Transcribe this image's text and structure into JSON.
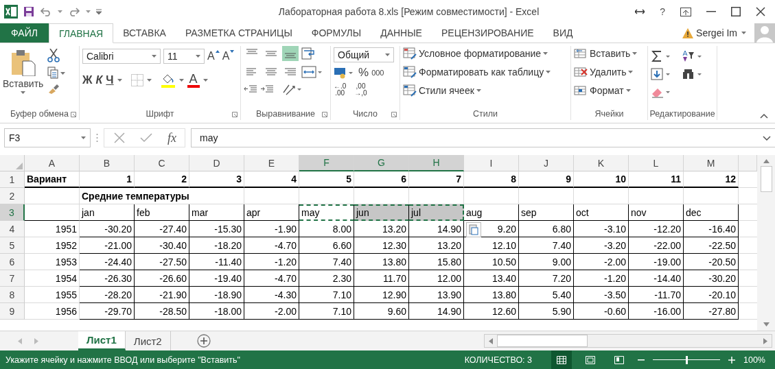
{
  "window": {
    "title": "Лабораторная работа 8.xls  [Режим совместимости] - Excel",
    "help": "?"
  },
  "tabs": [
    {
      "label": "ФАЙЛ",
      "kind": "file",
      "selected": false
    },
    {
      "label": "ГЛАВНАЯ",
      "kind": "tab",
      "selected": true
    },
    {
      "label": "ВСТАВКА",
      "kind": "tab",
      "selected": false
    },
    {
      "label": "РАЗМЕТКА СТРАНИЦЫ",
      "kind": "tab",
      "selected": false
    },
    {
      "label": "ФОРМУЛЫ",
      "kind": "tab",
      "selected": false
    },
    {
      "label": "ДАННЫЕ",
      "kind": "tab",
      "selected": false
    },
    {
      "label": "РЕЦЕНЗИРОВАНИЕ",
      "kind": "tab",
      "selected": false
    },
    {
      "label": "ВИД",
      "kind": "tab",
      "selected": false
    }
  ],
  "user": {
    "name": "Sergei Im"
  },
  "ribbon": {
    "clipboard": {
      "paste": "Вставить",
      "label": "Буфер обмена"
    },
    "font": {
      "name": "Calibri",
      "size": "11",
      "grow": "A",
      "shrink": "A",
      "bold": "Ж",
      "italic": "К",
      "underline": "Ч",
      "color_letter": "A",
      "label": "Шрифт"
    },
    "alignment": {
      "label": "Выравнивание",
      "buttons": [
        {
          "selected": false
        },
        {
          "selected": false
        },
        {
          "selected": true
        },
        {
          "selected": false
        },
        {
          "selected": false
        },
        {
          "selected": false
        }
      ]
    },
    "number": {
      "format": "Общий",
      "percent": "%",
      "thousands": "000",
      "increase_decimal": [
        "←.0",
        ".00"
      ],
      "decrease_decimal": [
        ",00",
        "→,0"
      ],
      "label": "Число"
    },
    "styles": {
      "buttons": [
        "Условное форматирование",
        "Форматировать как таблицу",
        "Стили ячеек"
      ],
      "label": "Стили"
    },
    "cells": {
      "buttons": [
        "Вставить",
        "Удалить",
        "Формат"
      ],
      "label": "Ячейки"
    },
    "editing": {
      "label": "Редактирование"
    }
  },
  "formula_bar": {
    "name_box": "F3",
    "fx": "fx",
    "value": "may"
  },
  "columns": [
    {
      "label": "A",
      "selected": false
    },
    {
      "label": "B",
      "selected": false
    },
    {
      "label": "C",
      "selected": false
    },
    {
      "label": "D",
      "selected": false
    },
    {
      "label": "E",
      "selected": false
    },
    {
      "label": "F",
      "selected": true
    },
    {
      "label": "G",
      "selected": true
    },
    {
      "label": "H",
      "selected": true
    },
    {
      "label": "I",
      "selected": false
    },
    {
      "label": "J",
      "selected": false
    },
    {
      "label": "K",
      "selected": false
    },
    {
      "label": "L",
      "selected": false
    },
    {
      "label": "M",
      "selected": false
    }
  ],
  "rows": [
    {
      "number": "1",
      "kind": "header",
      "selected": false,
      "cells": [
        "Вариант",
        "1",
        "2",
        "3",
        "4",
        "5",
        "6",
        "7",
        "8",
        "9",
        "10",
        "11",
        "12"
      ]
    },
    {
      "number": "2",
      "kind": "title",
      "selected": false,
      "cells": [
        null,
        "Средние температуры",
        null,
        null,
        null,
        null,
        null,
        null,
        null,
        null,
        null,
        null,
        null
      ]
    },
    {
      "number": "3",
      "kind": "labels",
      "selected": true,
      "cells": [
        null,
        "jan",
        "feb",
        "mar",
        "apr",
        "may",
        "jun",
        "jul",
        "aug",
        "sep",
        "oct",
        "nov",
        "dec"
      ]
    },
    {
      "number": "4",
      "kind": "data",
      "selected": false,
      "cells": [
        "1951",
        "-30.20",
        "-27.40",
        "-15.30",
        "-1.90",
        "8.00",
        "13.20",
        "14.90",
        "9.20",
        "6.80",
        "-3.10",
        "-12.20",
        "-16.40"
      ]
    },
    {
      "number": "5",
      "kind": "data",
      "selected": false,
      "cells": [
        "1952",
        "-21.00",
        "-30.40",
        "-18.20",
        "-4.70",
        "6.60",
        "12.30",
        "13.20",
        "12.10",
        "7.40",
        "-3.20",
        "-22.00",
        "-22.50"
      ]
    },
    {
      "number": "6",
      "kind": "data",
      "selected": false,
      "cells": [
        "1953",
        "-24.40",
        "-27.50",
        "-11.40",
        "-1.20",
        "7.40",
        "13.80",
        "15.80",
        "10.50",
        "9.00",
        "-2.00",
        "-19.00",
        "-20.50"
      ]
    },
    {
      "number": "7",
      "kind": "data",
      "selected": false,
      "cells": [
        "1954",
        "-26.30",
        "-26.60",
        "-19.40",
        "-4.70",
        "2.30",
        "11.70",
        "12.00",
        "13.40",
        "7.20",
        "-1.20",
        "-14.40",
        "-30.20"
      ]
    },
    {
      "number": "8",
      "kind": "data",
      "selected": false,
      "cells": [
        "1955",
        "-28.20",
        "-21.90",
        "-18.90",
        "-4.30",
        "7.10",
        "12.90",
        "13.90",
        "13.80",
        "5.40",
        "-3.50",
        "-11.70",
        "-20.10"
      ]
    },
    {
      "number": "9",
      "kind": "data",
      "selected": false,
      "cells": [
        "1956",
        "-29.70",
        "-28.50",
        "-18.00",
        "-2.00",
        "7.10",
        "9.60",
        "14.90",
        "12.60",
        "5.90",
        "-0.60",
        "-16.00",
        "-27.80"
      ]
    }
  ],
  "sheets": [
    {
      "label": "Лист1",
      "selected": true
    },
    {
      "label": "Лист2",
      "selected": false
    }
  ],
  "status_bar": {
    "message": "Укажите ячейку и нажмите ВВОД или выберите \"Вставить\"",
    "count": "КОЛИЧЕСТВО: 3",
    "views": [
      {
        "selected": true
      },
      {
        "selected": false
      },
      {
        "selected": false
      }
    ],
    "zoom": {
      "level": 0.5,
      "reading": "100%"
    }
  }
}
